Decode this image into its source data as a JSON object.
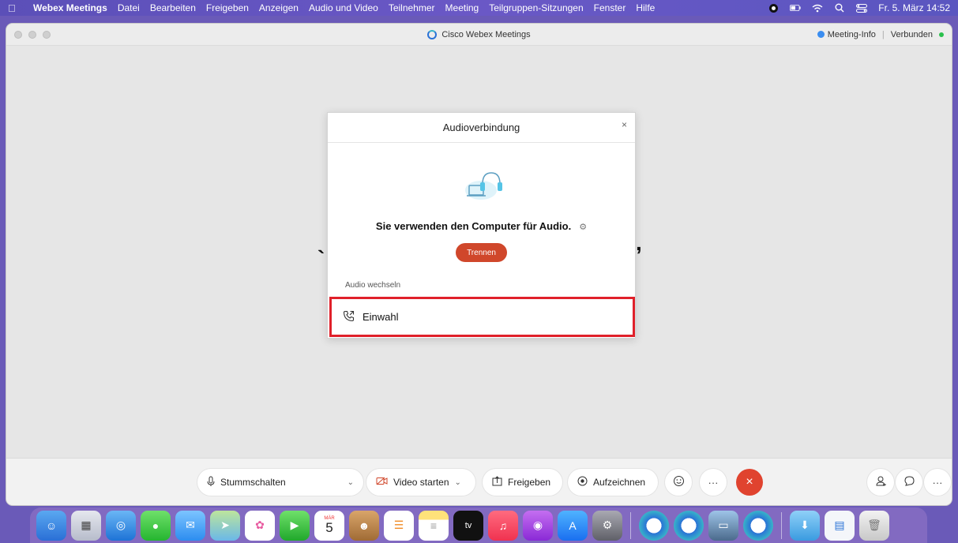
{
  "menubar": {
    "items": [
      "Webex Meetings",
      "Datei",
      "Bearbeiten",
      "Freigeben",
      "Anzeigen",
      "Audio und Video",
      "Teilnehmer",
      "Meeting",
      "Teilgruppen-Sitzungen",
      "Fenster",
      "Hilfe"
    ],
    "datetime": "Fr. 5. März  14:52"
  },
  "window": {
    "title": "Cisco Webex Meetings",
    "meeting_info": "Meeting-Info",
    "connection_status": "Verbunden"
  },
  "dialog": {
    "title": "Audioverbindung",
    "close": "×",
    "status_text": "Sie verwenden den Computer für Audio.",
    "disconnect_label": "Trennen",
    "switch_audio_label": "Audio wechseln",
    "dial_in_label": "Einwahl"
  },
  "controls": {
    "mute_label": "Stummschalten",
    "video_label": "Video starten",
    "share_label": "Freigeben",
    "record_label": "Aufzeichnen",
    "more": "···",
    "end": "×"
  },
  "dock": {
    "calendar_month": "MÄR",
    "calendar_day": "5",
    "tv_label": "tv"
  },
  "colors": {
    "accent_red": "#d0472b",
    "highlight_border": "#e0202a",
    "connected_green": "#2ac04c"
  }
}
